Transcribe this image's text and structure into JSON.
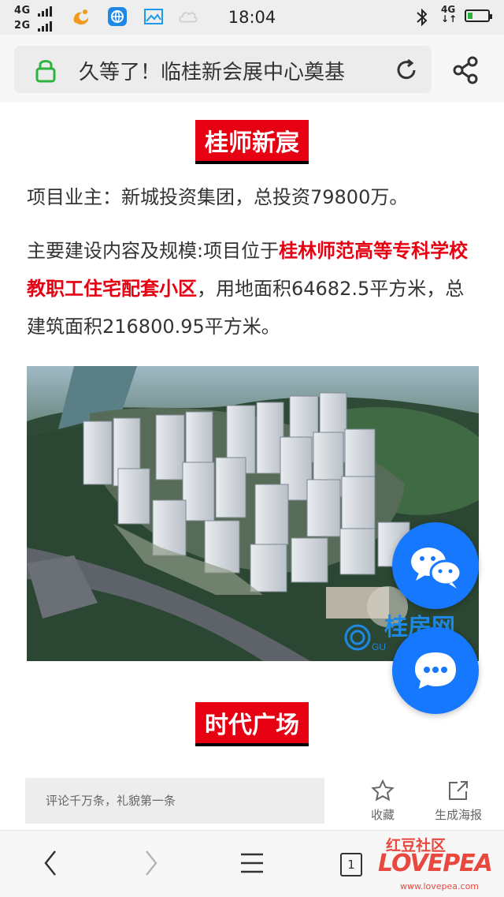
{
  "status_bar": {
    "signal_1": "4G",
    "signal_2": "2G",
    "time": "18:04",
    "network": "4G"
  },
  "url_bar": {
    "title": "久等了！临桂新会展中心奠基"
  },
  "article": {
    "section1_heading": "桂师新宸",
    "paragraph1": "项目业主：新城投资集团，总投资79800万。",
    "paragraph2_prefix": "主要建设内容及规模:项目位于",
    "paragraph2_highlight": "桂林师范高等专科学校教职工住宅配套小区",
    "paragraph2_suffix": "，用地面积64682.5平方米，总建筑面积216800.95平方米。",
    "photo_watermark": "桂房网",
    "photo_watermark_sub": "GU",
    "section2_heading": "时代广场"
  },
  "comment_bar": {
    "input_placeholder": "评论千万条，礼貌第一条",
    "favorite_label": "收藏",
    "poster_label": "生成海报"
  },
  "nav_bar": {
    "tab_count": "1"
  },
  "watermark": {
    "top": "红豆社区",
    "logo": "LOVEPEA",
    "url": "www.lovepea.com"
  },
  "colors": {
    "accent_red": "#e60012",
    "fab_blue": "#1677ff"
  }
}
